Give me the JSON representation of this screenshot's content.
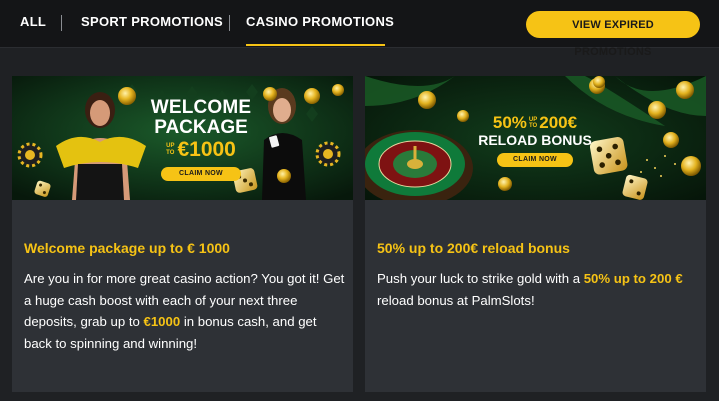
{
  "nav": {
    "tabs": [
      {
        "label": "ALL"
      },
      {
        "label": "SPORT PROMOTIONS"
      },
      {
        "label": "CASINO PROMOTIONS"
      }
    ],
    "expired_button": "VIEW EXPIRED PROMOTIONS"
  },
  "colors": {
    "accent": "#f6c315",
    "background": "#1f2124",
    "card": "#2e3136",
    "banner1_bg": "#0f3318",
    "banner2_bg": "#0c2a14"
  },
  "promos": [
    {
      "banner": {
        "line1": "WELCOME",
        "line2": "PACKAGE",
        "upto_a": "UP",
        "upto_b": "TO",
        "amount": "€1000",
        "claim": "CLAIM NOW"
      },
      "title": "Welcome package up to € 1000",
      "desc_a": "Are you in for more great casino action? You got it! Get a huge cash boost with each of your next three deposits, grab up to ",
      "desc_highlight": "€1000",
      "desc_b": " in bonus cash, and get back to spinning and winning!"
    },
    {
      "banner": {
        "pct": "50%",
        "upto_a": "UP",
        "upto_b": "TO",
        "amount": "200€",
        "line2": "RELOAD BONUS",
        "claim": "CLAIM NOW"
      },
      "title": "50% up to 200€ reload bonus",
      "desc_a": "Push your luck to strike gold with a ",
      "desc_highlight": "50% up to 200 €",
      "desc_b": " reload bonus at PalmSlots!"
    }
  ]
}
